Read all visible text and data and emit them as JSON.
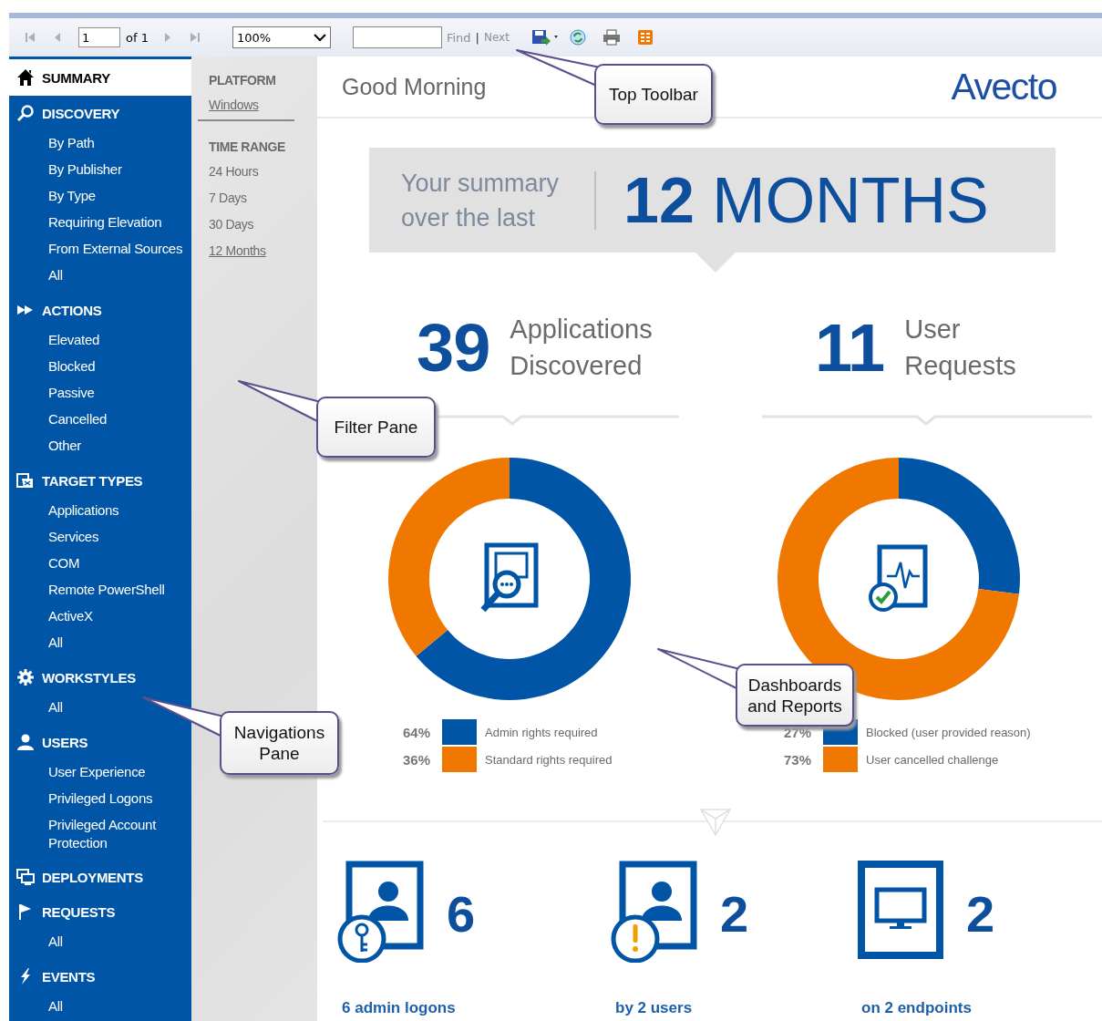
{
  "toolbar": {
    "page": "1",
    "page_count": "of 1",
    "zoom": "100%",
    "find_label": "Find",
    "separator": "|",
    "next_label": "Next"
  },
  "navigation": [
    {
      "label": "SUMMARY",
      "selected": true
    },
    {
      "label": "DISCOVERY",
      "selected": false,
      "children": [
        {
          "label": "By Path",
          "selected": false
        },
        {
          "label": "By Publisher",
          "selected": false
        },
        {
          "label": "By Type",
          "selected": false
        },
        {
          "label": "Requiring Elevation",
          "selected": false
        },
        {
          "label": "From External Sources",
          "selected": false
        },
        {
          "label": "All",
          "selected": false
        }
      ]
    },
    {
      "label": "ACTIONS",
      "selected": false,
      "children": [
        {
          "label": "Elevated",
          "selected": false
        },
        {
          "label": "Blocked",
          "selected": false
        },
        {
          "label": "Passive",
          "selected": false
        },
        {
          "label": "Cancelled",
          "selected": false
        },
        {
          "label": "Other",
          "selected": false
        }
      ]
    },
    {
      "label": "TARGET TYPES",
      "selected": false,
      "children": [
        {
          "label": "Applications",
          "selected": false
        },
        {
          "label": "Services",
          "selected": false
        },
        {
          "label": "COM",
          "selected": false
        },
        {
          "label": "Remote PowerShell",
          "selected": false
        },
        {
          "label": "ActiveX",
          "selected": false
        },
        {
          "label": "All",
          "selected": false
        }
      ]
    },
    {
      "label": "WORKSTYLES",
      "selected": false,
      "children": [
        {
          "label": "All",
          "selected": false
        }
      ]
    },
    {
      "label": "USERS",
      "selected": false,
      "children": [
        {
          "label": "User Experience",
          "selected": false
        },
        {
          "label": "Privileged Logons",
          "selected": false
        },
        {
          "label": "Privileged Account Protection",
          "selected": false
        }
      ]
    },
    {
      "label": "DEPLOYMENTS",
      "selected": false
    },
    {
      "label": "REQUESTS",
      "selected": false,
      "children": [
        {
          "label": "All",
          "selected": false
        }
      ]
    },
    {
      "label": "EVENTS",
      "selected": false,
      "children": [
        {
          "label": "All",
          "selected": false
        }
      ]
    }
  ],
  "filters": [
    {
      "heading": "PLATFORM",
      "options": [
        {
          "label": "Windows",
          "selected": true
        }
      ]
    },
    {
      "heading": "TIME RANGE",
      "options": [
        {
          "label": "24 Hours",
          "selected": false
        },
        {
          "label": "7 Days",
          "selected": false
        },
        {
          "label": "30 Days",
          "selected": false
        },
        {
          "label": "12 Months",
          "selected": true
        }
      ]
    }
  ],
  "greeting": "Good Morning",
  "logo": "Avecto",
  "summary_banner": {
    "lead": "Your summary over the last",
    "period": "**12** MONTHS"
  },
  "stats": [
    {
      "count": "39",
      "label": "Applications Discovered",
      "chart_data": {
        "type": "donut",
        "values": [
          64,
          36
        ]
      },
      "legend": [
        {
          "percent": "64%",
          "color": "#0055a6",
          "label": "Admin rights required"
        },
        {
          "percent": "36%",
          "color": "#f07800",
          "label": "Standard rights required"
        }
      ]
    },
    {
      "count": "11",
      "label": "User Requests",
      "chart_data": {
        "type": "donut",
        "values": [
          27,
          73
        ]
      },
      "legend": [
        {
          "percent": "27%",
          "color": "#0055a6",
          "label": "Blocked (user provided reason)"
        },
        {
          "percent": "73%",
          "color": "#f07800",
          "label": "User cancelled challenge"
        }
      ]
    }
  ],
  "highlights": [
    {
      "count": "6",
      "caption": "6 admin logons"
    },
    {
      "count": "2",
      "caption": "by 2 users"
    },
    {
      "count": "2",
      "caption": "on 2 endpoints"
    }
  ],
  "callouts": [
    {
      "text": "Top Toolbar"
    },
    {
      "text": "Filter Pane"
    },
    {
      "text": "Navigations Pane"
    },
    {
      "text": "Dashboards and Reports"
    }
  ]
}
